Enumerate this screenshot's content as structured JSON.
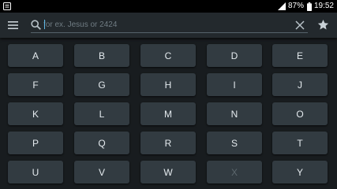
{
  "status_bar": {
    "battery": "87%",
    "time": "19:52",
    "icons": [
      "notification-icon",
      "signal-icon",
      "battery-icon"
    ]
  },
  "toolbar": {
    "menu_icon": "menu-icon",
    "search_icon": "search-icon",
    "search_value": "",
    "search_placeholder": "for ex. Jesus or 2424",
    "clear_icon": "close-icon",
    "favorite_icon": "star-icon"
  },
  "keyboard": {
    "rows": [
      [
        {
          "label": "A",
          "enabled": true
        },
        {
          "label": "B",
          "enabled": true
        },
        {
          "label": "C",
          "enabled": true
        },
        {
          "label": "D",
          "enabled": true
        },
        {
          "label": "E",
          "enabled": true
        }
      ],
      [
        {
          "label": "F",
          "enabled": true
        },
        {
          "label": "G",
          "enabled": true
        },
        {
          "label": "H",
          "enabled": true
        },
        {
          "label": "I",
          "enabled": true
        },
        {
          "label": "J",
          "enabled": true
        }
      ],
      [
        {
          "label": "K",
          "enabled": true
        },
        {
          "label": "L",
          "enabled": true
        },
        {
          "label": "M",
          "enabled": true
        },
        {
          "label": "N",
          "enabled": true
        },
        {
          "label": "O",
          "enabled": true
        }
      ],
      [
        {
          "label": "P",
          "enabled": true
        },
        {
          "label": "Q",
          "enabled": true
        },
        {
          "label": "R",
          "enabled": true
        },
        {
          "label": "S",
          "enabled": true
        },
        {
          "label": "T",
          "enabled": true
        }
      ],
      [
        {
          "label": "U",
          "enabled": true
        },
        {
          "label": "V",
          "enabled": true
        },
        {
          "label": "W",
          "enabled": true
        },
        {
          "label": "X",
          "enabled": false
        },
        {
          "label": "Y",
          "enabled": true
        }
      ]
    ]
  },
  "colors": {
    "background": "#181c1f",
    "toolbar": "#23292d",
    "key": "#323b41",
    "key_text": "#e4eaee",
    "key_disabled_text": "#5c676d",
    "accent": "#5fb8e6"
  }
}
